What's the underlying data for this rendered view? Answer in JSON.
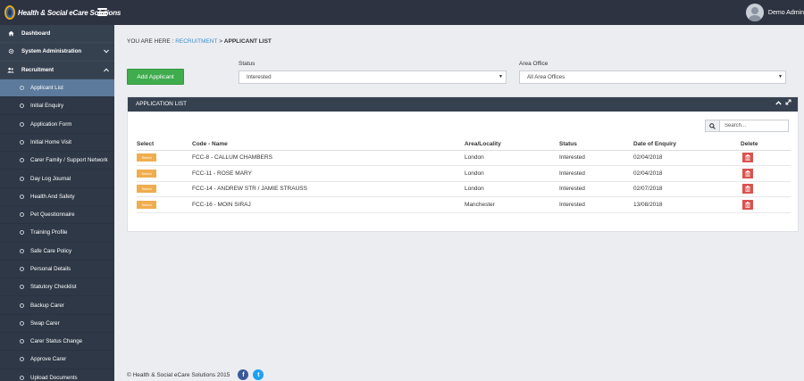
{
  "app": {
    "logo_text": "Health & Social eCare Solutions",
    "user_name": "Demo Admin"
  },
  "sidebar": {
    "items": [
      {
        "label": "Dashboard",
        "icon": "home-icon"
      },
      {
        "label": "System Administration",
        "icon": "gear-icon"
      },
      {
        "label": "Recruitment",
        "icon": "users-icon"
      }
    ],
    "sub_items": [
      {
        "label": "Applicant List"
      },
      {
        "label": "Initial Enquiry"
      },
      {
        "label": "Application Form"
      },
      {
        "label": "Initial Home Visit"
      },
      {
        "label": "Carer Family / Support Network"
      },
      {
        "label": "Day Log Journal"
      },
      {
        "label": "Health And Safety"
      },
      {
        "label": "Pet Questionnaire"
      },
      {
        "label": "Training Profile"
      },
      {
        "label": "Safe Care Policy"
      },
      {
        "label": "Personal Details"
      },
      {
        "label": "Statutory Checklist"
      },
      {
        "label": "Backup Carer"
      },
      {
        "label": "Swap Carer"
      },
      {
        "label": "Carer Status Change"
      },
      {
        "label": "Approve Carer"
      },
      {
        "label": "Upload Documents"
      }
    ]
  },
  "breadcrumb": {
    "prefix": "YOU ARE HERE :",
    "link": "RECRUITMENT",
    "separator": ">",
    "current": "APPLICANT LIST"
  },
  "toolbar": {
    "add_label": "Add Applicant",
    "status_label": "Status",
    "status_value": "Interested",
    "area_label": "Area Office",
    "area_value": "All Area Offices"
  },
  "panel": {
    "title": "APPLICATION LIST",
    "search_placeholder": "Search..."
  },
  "table": {
    "headers": [
      "Select",
      "Code - Name",
      "Area/Locality",
      "Status",
      "Date of Enquiry",
      "Delete"
    ],
    "select_label": "Select",
    "rows": [
      {
        "code_name": "FCC-8 - CALLUM CHAMBERS",
        "area": "London",
        "status": "Interested",
        "date": "02/04/2018"
      },
      {
        "code_name": "FCC-11 - ROSE MARY",
        "area": "London",
        "status": "Interested",
        "date": "02/04/2018"
      },
      {
        "code_name": "FCC-14 - ANDREW STR / JAMIE STRAUSS",
        "area": "London",
        "status": "Interested",
        "date": "02/07/2018"
      },
      {
        "code_name": "FCC-16 - MOIN SIRAJ",
        "area": "Manchester",
        "status": "Interested",
        "date": "13/08/2018"
      }
    ]
  },
  "footer": {
    "copyright": "© Health & Social eCare Solutions 2015",
    "facebook_glyph": "f",
    "twitter_glyph": "t"
  },
  "colors": {
    "topbar": "#2d3340",
    "sidebar": "#364150",
    "active_item": "#5b7a9c",
    "add_button": "#3fac4d",
    "select_button": "#f0ad4e",
    "delete_button": "#d9534f",
    "facebook": "#3b5998",
    "twitter": "#1da1f2"
  }
}
